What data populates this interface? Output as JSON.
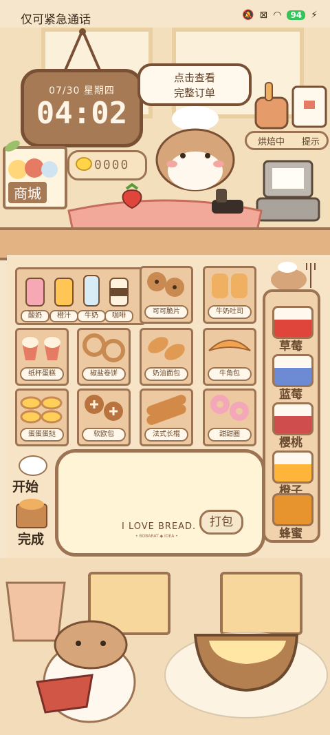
{
  "status_bar": {
    "carrier": "仅可紧急通话",
    "battery": "94"
  },
  "clock": {
    "date": "07/30 星期四",
    "time": "04:02"
  },
  "order_bubble": {
    "line1": "点击查看",
    "line2": "完整订单"
  },
  "top_right": {
    "baking": "烘焙中",
    "hint": "提示"
  },
  "shop": {
    "label": "商城"
  },
  "coins": {
    "value": "0000"
  },
  "drinks": [
    {
      "label": "酸奶"
    },
    {
      "label": "橙汁"
    },
    {
      "label": "牛奶"
    },
    {
      "label": "咖啡"
    }
  ],
  "breads": [
    {
      "label": "可可脆片"
    },
    {
      "label": "牛奶吐司"
    },
    {
      "label": "纸杯蛋糕"
    },
    {
      "label": "椒盐卷饼"
    },
    {
      "label": "奶油面包"
    },
    {
      "label": "牛角包"
    },
    {
      "label": "蛋蛋蛋挞"
    },
    {
      "label": "软欧包"
    },
    {
      "label": "法式长棍"
    },
    {
      "label": "甜甜圈"
    }
  ],
  "fillings": [
    {
      "label": "草莓"
    },
    {
      "label": "蓝莓"
    },
    {
      "label": "樱桃"
    },
    {
      "label": "橙子"
    },
    {
      "label": "蜂蜜"
    }
  ],
  "tray": {
    "brand": "I LOVE BREAD.",
    "sub": "• BOBARAT ◆ IDEA •",
    "pack": "打包"
  },
  "actions": {
    "start": "开始",
    "done": "完成"
  },
  "colors": {
    "wood": "#9c7453",
    "cream": "#fff4de",
    "accent": "#e57b63"
  }
}
